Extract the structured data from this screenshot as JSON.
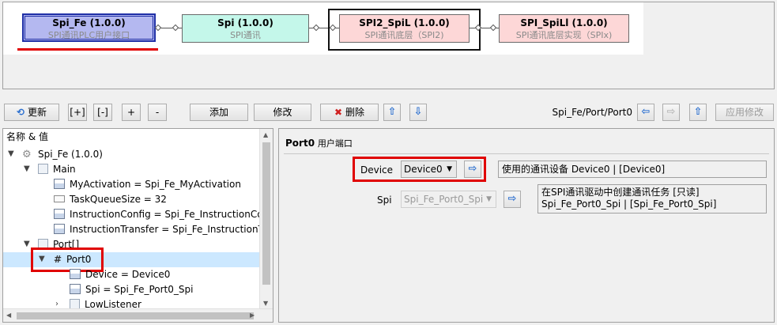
{
  "diagram": {
    "nodes": [
      {
        "title": "Spi_Fe (1.0.0)",
        "subtitle": "SPI通讯PLC用户接口",
        "fill": "#b4b8f0",
        "border": "#1f2fa6"
      },
      {
        "title": "Spi (1.0.0)",
        "subtitle": "SPI通讯",
        "fill": "#c4f7ea",
        "border": "#6a6a6a"
      },
      {
        "title": "SPI2_SpiL (1.0.0)",
        "subtitle": "SPI通讯底层（SPI2)",
        "fill": "#fdd7d7",
        "border": "#6a6a6a"
      },
      {
        "title": "SPI_SpiLl (1.0.0)",
        "subtitle": "SPI通讯底层实现（SPIx)",
        "fill": "#fdd7d7",
        "border": "#6a6a6a"
      }
    ]
  },
  "toolbar": {
    "refresh": "更新",
    "expand": "[+]",
    "collapse": "[-]",
    "plus": "+",
    "minus": "-",
    "add": "添加",
    "modify": "修改",
    "delete": "删除",
    "path": "Spi_Fe/Port/Port0",
    "apply": "应用修改"
  },
  "tree": {
    "header": "名称 & 值",
    "root": "Spi_Fe (1.0.0)",
    "main": "Main",
    "main_items": [
      "MyActivation = Spi_Fe_MyActivation",
      "TaskQueueSize = 32",
      "InstructionConfig = Spi_Fe_InstructionCon",
      "InstructionTransfer = Spi_Fe_InstructionTr"
    ],
    "port": "Port[]",
    "port0": "Port0",
    "port0_items": [
      "Device = Device0",
      "Spi = Spi_Fe_Port0_Spi"
    ],
    "low_listener": "LowListener"
  },
  "properties": {
    "title": "Port0",
    "title_suffix": "用户端口",
    "device_label": "Device",
    "device_value": "Device0",
    "device_desc": "使用的通讯设备 Device0 | [Device0]",
    "spi_label": "Spi",
    "spi_value": "Spi_Fe_Port0_Spi",
    "spi_desc_line1": "在SPI通讯驱动中创建通讯任务 [只读]",
    "spi_desc_line2": "Spi_Fe_Port0_Spi | [Spi_Fe_Port0_Spi]"
  },
  "colors": {
    "highlight_red": "#e00000",
    "selection": "#cce8ff",
    "accent_blue": "#1f2fa6"
  }
}
